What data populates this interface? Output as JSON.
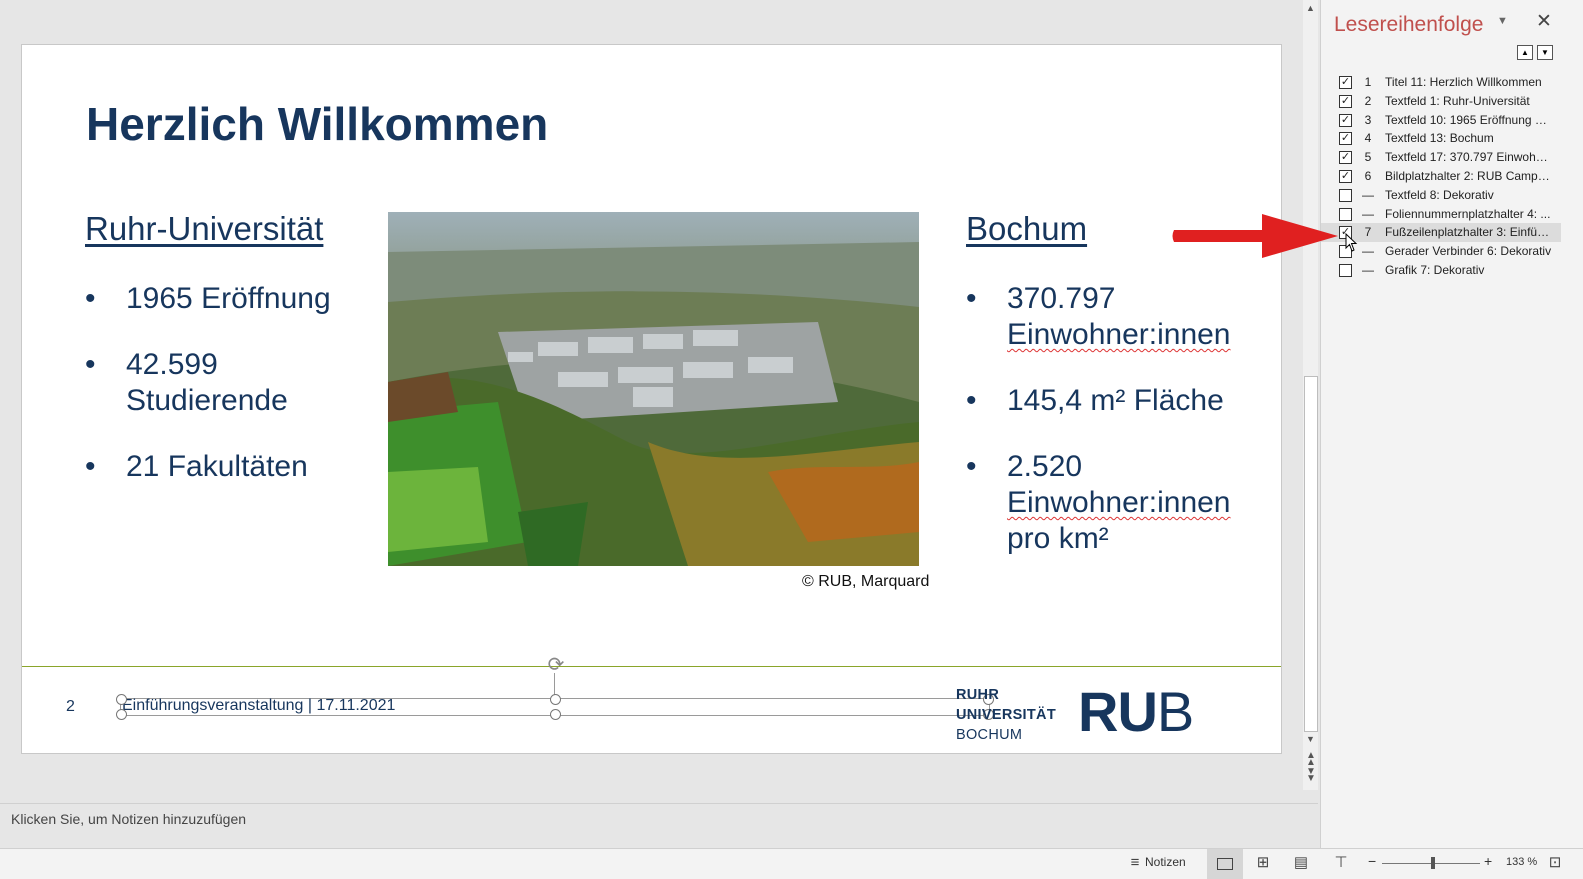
{
  "slide": {
    "title": "Herzlich Willkommen",
    "left_heading": "Ruhr-Universität",
    "left_bullets": [
      "1965 Eröffnung",
      "42.599 Studierende",
      "21 Fakultäten"
    ],
    "right_heading": "Bochum",
    "right_bullets": [
      {
        "a": "370.797",
        "b": "Einwohner:innen"
      },
      {
        "a": "145,4 m² Fläche"
      },
      {
        "a": "2.520",
        "b": "Einwohner:innen",
        "c": "pro km²"
      }
    ],
    "photo_credit": "© RUB, Marquard",
    "slide_number": "2",
    "footer_text": "Einführungsveranstaltung | 17.11.2021",
    "logo_word": [
      "RUHR",
      "UNIVERSITÄT",
      "BOCHUM"
    ],
    "logo_mark_ru": "RU",
    "logo_mark_b": "B"
  },
  "notes_placeholder": "Klicken Sie, um Notizen hinzuzufügen",
  "pane": {
    "title": "Lesereihenfolge",
    "items": [
      {
        "checked": true,
        "num": "1",
        "label": "Titel 11: Herzlich Willkommen"
      },
      {
        "checked": true,
        "num": "2",
        "label": "Textfeld 1: Ruhr-Universität"
      },
      {
        "checked": true,
        "num": "3",
        "label": "Textfeld 10: 1965 Eröffnung 42..."
      },
      {
        "checked": true,
        "num": "4",
        "label": "Textfeld 13: Bochum"
      },
      {
        "checked": true,
        "num": "5",
        "label": "Textfeld 17: 370.797 Einwohne..."
      },
      {
        "checked": true,
        "num": "6",
        "label": "Bildplatzhalter 2: RUB Campus..."
      },
      {
        "checked": false,
        "num": "—",
        "label": "Textfeld 8: Dekorativ"
      },
      {
        "checked": false,
        "num": "—",
        "label": "Foliennummernplatzhalter 4: ..."
      },
      {
        "checked": true,
        "num": "7",
        "label": "Fußzeilenplatzhalter 3: Einführ...",
        "selected": true
      },
      {
        "checked": false,
        "num": "—",
        "label": "Gerader Verbinder 6: Dekorativ"
      },
      {
        "checked": false,
        "num": "—",
        "label": "Grafik 7: Dekorativ"
      }
    ]
  },
  "status": {
    "notes_label": "Notizen",
    "zoom": "133 %"
  },
  "colors": {
    "slide_text": "#17365d",
    "pane_title": "#c0504d",
    "footer_line": "#8aa52a",
    "arrow": "#e02020"
  }
}
